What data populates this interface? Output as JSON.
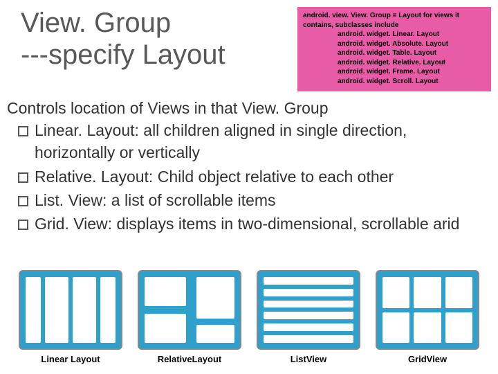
{
  "title": {
    "line1": "View. Group",
    "line2": "---specify Layout"
  },
  "pink_box": {
    "heading": "android. view. View. Group = Layout for views it contains, subclasses include",
    "items": [
      "android. widget. Linear. Layout",
      "android. widget. Absolute. Layout",
      "android. widget. Table. Layout",
      "android. widget. Relative. Layout",
      "android. widget. Frame. Layout",
      "android. widget. Scroll. Layout"
    ]
  },
  "intro": "Controls location of Views in that View. Group",
  "bullets": [
    "Linear. Layout: all children aligned in single direction, horizontally or vertically",
    "Relative. Layout: Child object relative to each other",
    "List. View: a list of scrollable items",
    "Grid. View: displays items in two-dimensional, scrollable arid"
  ],
  "diagrams": [
    {
      "caption": "Linear Layout"
    },
    {
      "caption": "RelativeLayout"
    },
    {
      "caption": "ListView"
    },
    {
      "caption": "GridView"
    }
  ]
}
